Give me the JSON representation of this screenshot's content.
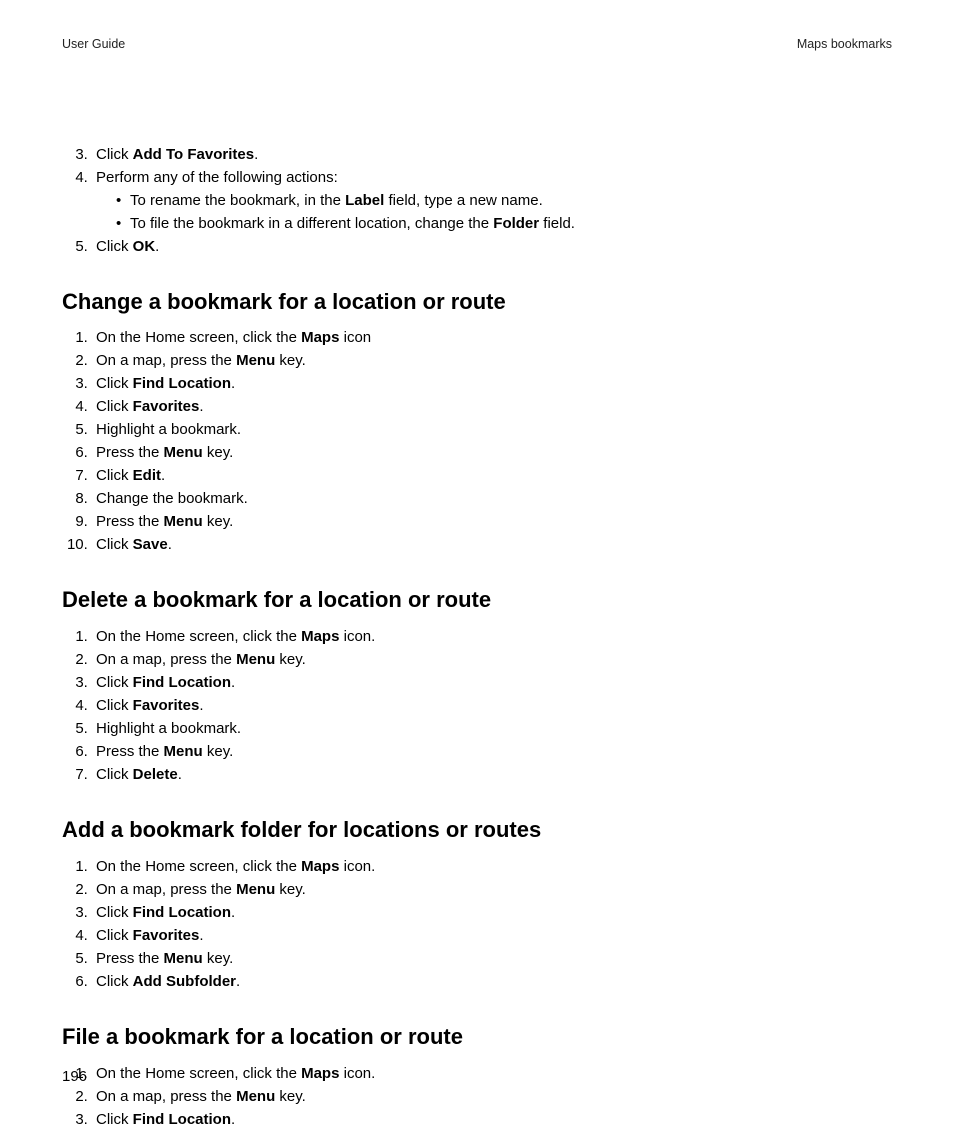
{
  "header": {
    "left": "User Guide",
    "right": "Maps bookmarks"
  },
  "top": {
    "start": 3,
    "items": [
      {
        "parts": [
          {
            "t": "Click "
          },
          {
            "t": "Add To Favorites",
            "b": true
          },
          {
            "t": "."
          }
        ]
      },
      {
        "parts": [
          {
            "t": "Perform any of the following actions:"
          }
        ],
        "sub": [
          [
            {
              "t": "To rename the bookmark, in the "
            },
            {
              "t": "Label",
              "b": true
            },
            {
              "t": " field, type a new name."
            }
          ],
          [
            {
              "t": "To file the bookmark in a different location, change the "
            },
            {
              "t": "Folder",
              "b": true
            },
            {
              "t": " field."
            }
          ]
        ]
      },
      {
        "parts": [
          {
            "t": "Click "
          },
          {
            "t": "OK",
            "b": true
          },
          {
            "t": "."
          }
        ]
      }
    ]
  },
  "sections": [
    {
      "heading": "Change a bookmark for a location or route",
      "items": [
        [
          {
            "t": "On the Home screen, click the "
          },
          {
            "t": "Maps",
            "b": true
          },
          {
            "t": " icon"
          }
        ],
        [
          {
            "t": "On a map, press the "
          },
          {
            "t": "Menu",
            "b": true
          },
          {
            "t": " key."
          }
        ],
        [
          {
            "t": "Click "
          },
          {
            "t": "Find Location",
            "b": true
          },
          {
            "t": "."
          }
        ],
        [
          {
            "t": "Click "
          },
          {
            "t": "Favorites",
            "b": true
          },
          {
            "t": "."
          }
        ],
        [
          {
            "t": "Highlight a bookmark."
          }
        ],
        [
          {
            "t": "Press the "
          },
          {
            "t": "Menu",
            "b": true
          },
          {
            "t": " key."
          }
        ],
        [
          {
            "t": "Click "
          },
          {
            "t": "Edit",
            "b": true
          },
          {
            "t": "."
          }
        ],
        [
          {
            "t": "Change the bookmark."
          }
        ],
        [
          {
            "t": "Press the "
          },
          {
            "t": "Menu",
            "b": true
          },
          {
            "t": " key."
          }
        ],
        [
          {
            "t": "Click "
          },
          {
            "t": "Save",
            "b": true
          },
          {
            "t": "."
          }
        ]
      ]
    },
    {
      "heading": "Delete a bookmark for a location or route",
      "items": [
        [
          {
            "t": "On the Home screen, click the "
          },
          {
            "t": "Maps",
            "b": true
          },
          {
            "t": " icon."
          }
        ],
        [
          {
            "t": "On a map, press the "
          },
          {
            "t": "Menu",
            "b": true
          },
          {
            "t": " key."
          }
        ],
        [
          {
            "t": "Click "
          },
          {
            "t": "Find Location",
            "b": true
          },
          {
            "t": "."
          }
        ],
        [
          {
            "t": "Click "
          },
          {
            "t": "Favorites",
            "b": true
          },
          {
            "t": "."
          }
        ],
        [
          {
            "t": "Highlight a bookmark."
          }
        ],
        [
          {
            "t": "Press the "
          },
          {
            "t": "Menu",
            "b": true
          },
          {
            "t": " key."
          }
        ],
        [
          {
            "t": "Click "
          },
          {
            "t": "Delete",
            "b": true
          },
          {
            "t": "."
          }
        ]
      ]
    },
    {
      "heading": "Add a bookmark folder for locations or routes",
      "items": [
        [
          {
            "t": "On the Home screen, click the "
          },
          {
            "t": "Maps",
            "b": true
          },
          {
            "t": " icon."
          }
        ],
        [
          {
            "t": "On a map, press the "
          },
          {
            "t": "Menu",
            "b": true
          },
          {
            "t": " key."
          }
        ],
        [
          {
            "t": "Click "
          },
          {
            "t": "Find Location",
            "b": true
          },
          {
            "t": "."
          }
        ],
        [
          {
            "t": "Click "
          },
          {
            "t": "Favorites",
            "b": true
          },
          {
            "t": "."
          }
        ],
        [
          {
            "t": "Press the "
          },
          {
            "t": "Menu",
            "b": true
          },
          {
            "t": " key."
          }
        ],
        [
          {
            "t": "Click "
          },
          {
            "t": "Add Subfolder",
            "b": true
          },
          {
            "t": "."
          }
        ]
      ]
    },
    {
      "heading": "File a bookmark for a location or route",
      "items": [
        [
          {
            "t": "On the Home screen, click the "
          },
          {
            "t": "Maps",
            "b": true
          },
          {
            "t": " icon."
          }
        ],
        [
          {
            "t": "On a map, press the "
          },
          {
            "t": "Menu",
            "b": true
          },
          {
            "t": " key."
          }
        ],
        [
          {
            "t": "Click "
          },
          {
            "t": "Find Location",
            "b": true
          },
          {
            "t": "."
          }
        ]
      ]
    }
  ],
  "pageNumber": "196"
}
